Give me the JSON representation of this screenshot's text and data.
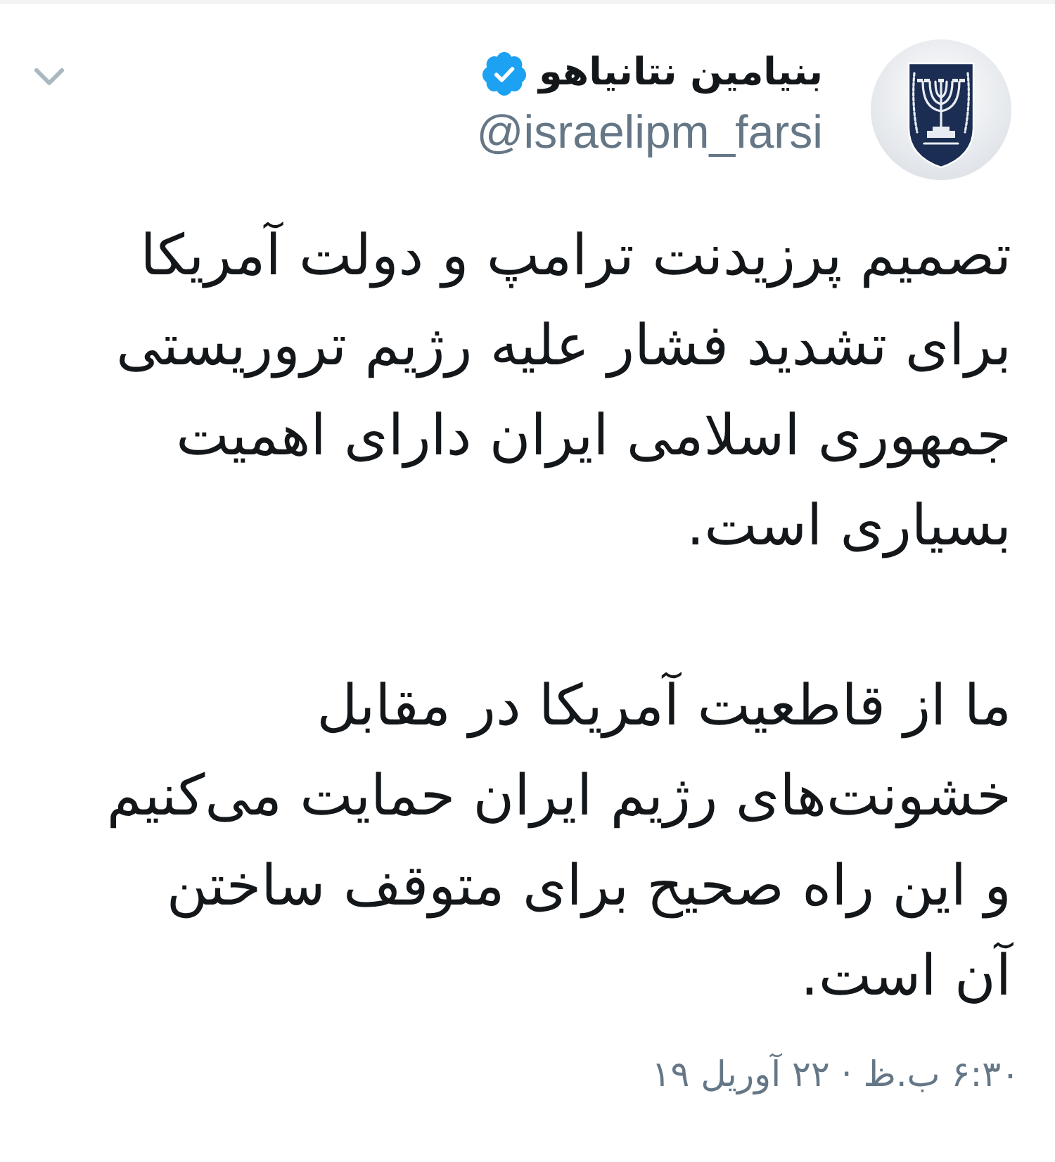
{
  "tweet": {
    "author": {
      "name": "بنیامین نتانیاهو",
      "verified": true,
      "handle": "@israelipm_farsi"
    },
    "paragraphs": [
      {
        "lines": [
          "تصمیم پرزیدنت ترامپ و دولت آمریکا",
          "برای تشدید فشار علیه رژیم تروریستی",
          "جمهوری اسلامی ایران دارای اهمیت",
          "بسیاری است."
        ]
      },
      {
        "lines": [
          "ما از قاطعیت آمریکا در مقابل",
          "خشونت‌های رژیم ایران حمایت می‌کنیم",
          "و این راه صحیح برای متوقف ساختن",
          "آن است."
        ]
      }
    ],
    "timestamp": "۶:۳۰ ب.ظ · ۲۲ آوریل ۱۹"
  }
}
